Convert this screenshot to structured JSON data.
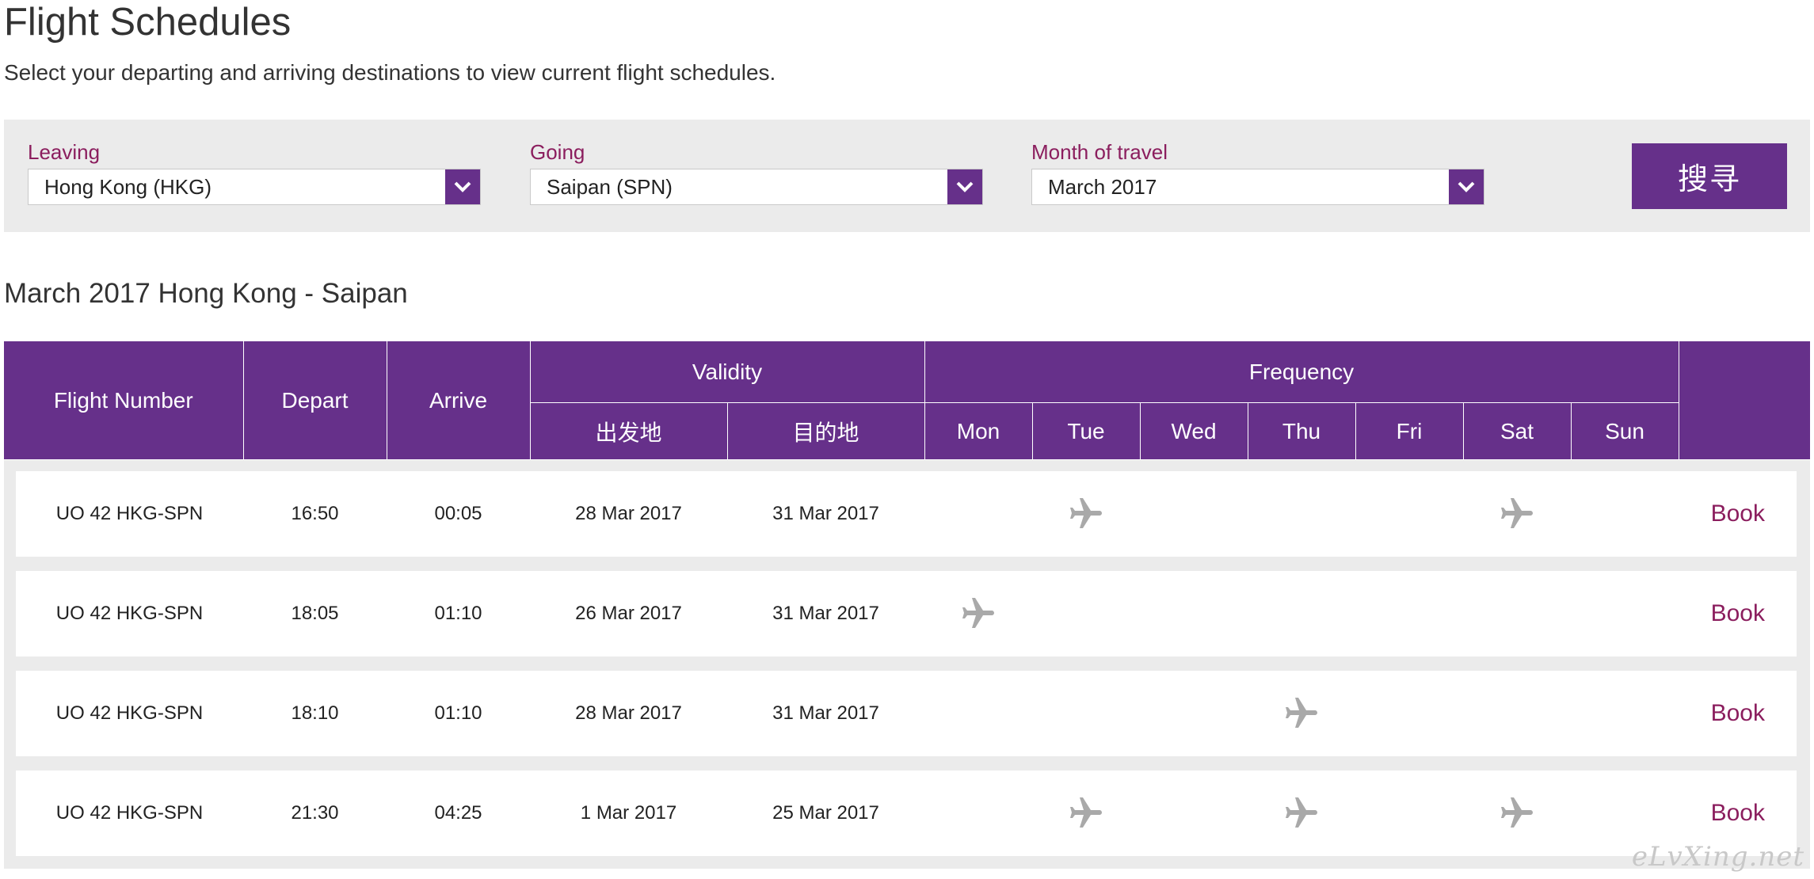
{
  "page": {
    "title": "Flight Schedules",
    "subtitle": "Select your departing and arriving destinations to view current flight schedules."
  },
  "search": {
    "leaving": {
      "label": "Leaving",
      "value": "Hong Kong (HKG)"
    },
    "going": {
      "label": "Going",
      "value": "Saipan (SPN)"
    },
    "month": {
      "label": "Month of travel",
      "value": "March 2017"
    },
    "button_label": "搜寻"
  },
  "results": {
    "heading": "March 2017 Hong Kong - Saipan",
    "headers": {
      "flight_number": "Flight Number",
      "depart": "Depart",
      "arrive": "Arrive",
      "validity": "Validity",
      "validity_from": "出发地",
      "validity_to": "目的地",
      "frequency": "Frequency",
      "days": [
        "Mon",
        "Tue",
        "Wed",
        "Thu",
        "Fri",
        "Sat",
        "Sun"
      ]
    },
    "rows": [
      {
        "flight": "UO 42 HKG-SPN",
        "depart": "16:50",
        "arrive": "00:05",
        "from": "28 Mar 2017",
        "to": "31 Mar 2017",
        "days": [
          false,
          true,
          false,
          false,
          false,
          true,
          false
        ],
        "book": "Book"
      },
      {
        "flight": "UO 42 HKG-SPN",
        "depart": "18:05",
        "arrive": "01:10",
        "from": "26 Mar 2017",
        "to": "31 Mar 2017",
        "days": [
          true,
          false,
          false,
          false,
          false,
          false,
          false
        ],
        "book": "Book"
      },
      {
        "flight": "UO 42 HKG-SPN",
        "depart": "18:10",
        "arrive": "01:10",
        "from": "28 Mar 2017",
        "to": "31 Mar 2017",
        "days": [
          false,
          false,
          false,
          true,
          false,
          false,
          false
        ],
        "book": "Book"
      },
      {
        "flight": "UO 42 HKG-SPN",
        "depart": "21:30",
        "arrive": "04:25",
        "from": "1 Mar 2017",
        "to": "25 Mar 2017",
        "days": [
          false,
          true,
          false,
          true,
          false,
          true,
          false
        ],
        "book": "Book"
      }
    ]
  },
  "icons": {
    "select_arrow": "chevron-down-icon",
    "frequency_marker": "airplane-icon"
  },
  "colors": {
    "brand_purple": "#66308a",
    "accent_magenta": "#8b1e5e",
    "plane_gray": "#a9a9a9",
    "panel_gray": "#ebebeb"
  },
  "watermark": "eLvXing.net"
}
